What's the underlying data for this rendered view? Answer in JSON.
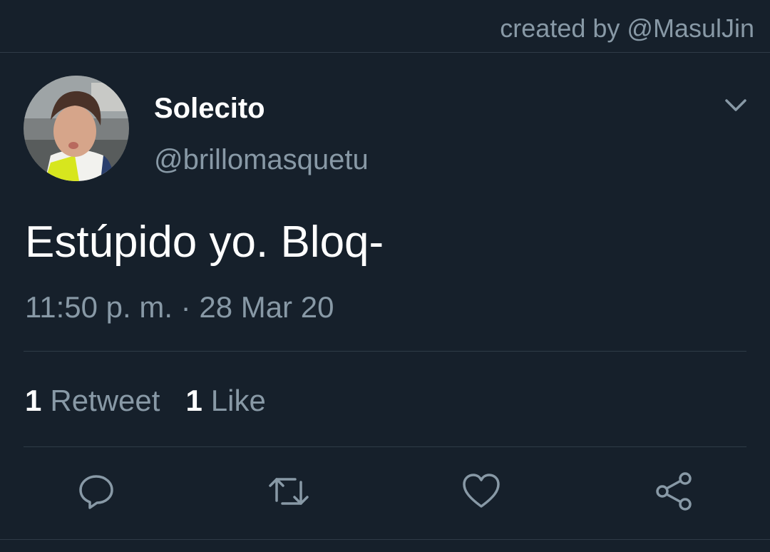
{
  "header": {
    "credit": "created by @MasulJin"
  },
  "tweet": {
    "display_name": "Solecito",
    "handle": "@brillomasquetu",
    "text": "Estúpido yo. Bloq-",
    "timestamp": "11:50 p. m. · 28 Mar 20",
    "stats": {
      "retweets_count": "1",
      "retweets_label": "Retweet",
      "likes_count": "1",
      "likes_label": "Like"
    }
  },
  "actions": [
    "reply-icon",
    "retweet-icon",
    "like-icon",
    "share-icon"
  ],
  "colors": {
    "background": "#16202b",
    "primary_text": "#ffffff",
    "secondary_text": "#8899a6",
    "divider": "#2f3b47"
  }
}
